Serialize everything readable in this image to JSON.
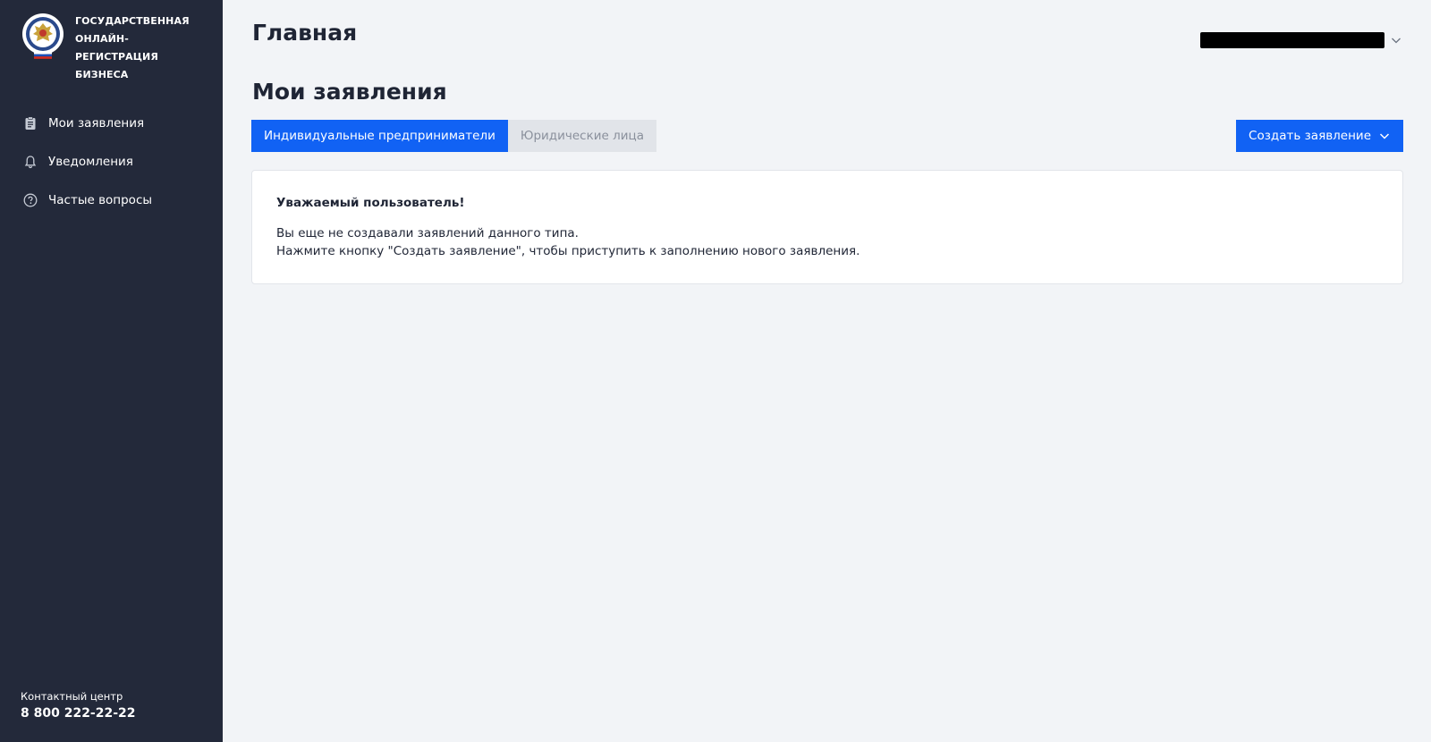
{
  "sidebar": {
    "logo": {
      "lines": [
        "ГОСУДАРСТВЕННАЯ",
        "ОНЛАЙН-РЕГИСТРАЦИЯ",
        "БИЗНЕСА"
      ]
    },
    "items": [
      {
        "label": "Мои заявления",
        "icon": "clipboard-icon"
      },
      {
        "label": "Уведомления",
        "icon": "bell-icon"
      },
      {
        "label": "Частые вопросы",
        "icon": "question-circle-icon"
      }
    ],
    "contact": {
      "label": "Контактный центр",
      "phone": "8 800 222-22-22"
    }
  },
  "header": {
    "title": "Главная",
    "user_menu_icon": "chevron-down-icon"
  },
  "main": {
    "section_title": "Мои заявления",
    "tabs": [
      {
        "label": "Индивидуальные предприниматели",
        "active": true
      },
      {
        "label": "Юридические лица",
        "active": false
      }
    ],
    "create_button": {
      "label": "Создать заявление",
      "icon": "chevron-down-icon"
    },
    "notice": {
      "title": "Уважаемый пользователь!",
      "line1": "Вы еще не создавали заявлений данного типа.",
      "line2": "Нажмите кнопку \"Создать заявление\", чтобы приступить к заполнению нового заявления."
    }
  },
  "colors": {
    "sidebar_bg": "#23293a",
    "page_bg": "#f2f4f7",
    "accent": "#1162f4",
    "tab_inactive_bg": "#e1e4e9",
    "text_dark": "#1f2535"
  }
}
